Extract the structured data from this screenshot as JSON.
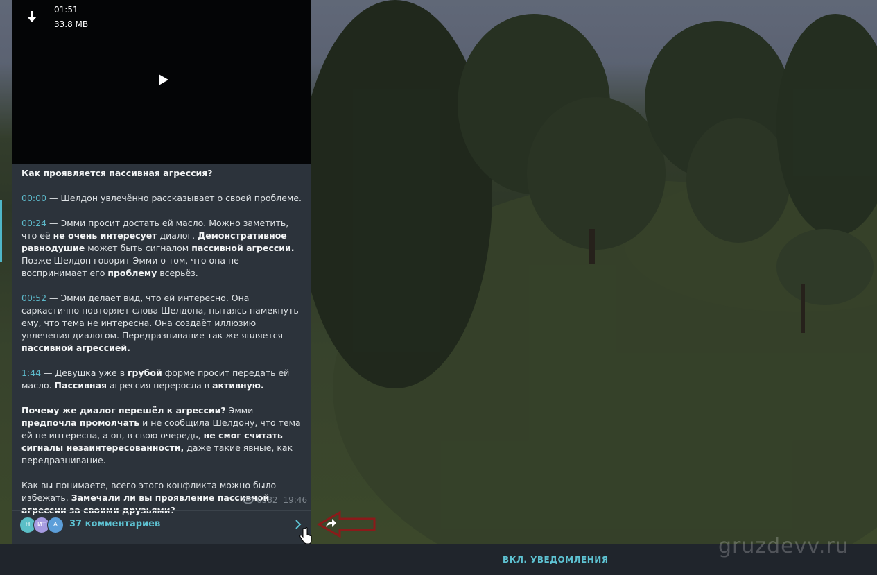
{
  "video": {
    "duration": "01:51",
    "size": "33.8 MB",
    "download_icon": "download-arrow-icon",
    "play_icon": "play-icon"
  },
  "post": {
    "title": "Как проявляется пассивная агрессия?",
    "p1_time": "00:00",
    "p1_text": " — Шелдон увлечённо рассказывает о своей проблеме.",
    "p2_time": "00:24",
    "p2_a": " — Эмми просит достать ей масло. Можно заметить, что её ",
    "p2_b": "не очень интересует",
    "p2_c": " диалог. ",
    "p2_d": "Демонстративное равнодушие",
    "p2_e": " может быть сигналом ",
    "p2_f": "пассивной агрессии.",
    "p2_g": " Позже Шелдон говорит Эмми о том, что она не воспринимает его ",
    "p2_h": "проблему",
    "p2_i": " всерьёз.",
    "p3_time": "00:52",
    "p3_a": " — Эмми делает вид, что ей интересно. Она саркастично повторяет слова Шелдона, пытаясь намекнуть ему, что тема не интересна. Она создаёт иллюзию увлечения диалогом. Передразнивание так же является ",
    "p3_b": "пассивной агрессией.",
    "p4_time": "1:44",
    "p4_a": " — Девушка уже в ",
    "p4_b": "грубой",
    "p4_c": " форме просит передать ей масло. ",
    "p4_d": "Пассивная",
    "p4_e": " агрессия переросла в ",
    "p4_f": "активную.",
    "p5_a": "Почему же диалог перешёл к агрессии?",
    "p5_b": " Эмми ",
    "p5_c": "предпочла промолчать",
    "p5_d": " и не сообщила Шелдону, что тема ей не интересна, а он, в свою очередь, ",
    "p5_e": "не смог считать сигналы незаинтересованности,",
    "p5_f": " даже такие явные, как передразнивание.",
    "p6_a": "Как вы понимаете, всего этого конфликта можно было избежать. ",
    "p6_b": "Замечали ли вы проявление пассивной агрессии за своими друзьями?",
    "views": "6582",
    "time": "19:46"
  },
  "comments": {
    "avatars": [
      "Н",
      "ИТ",
      "А"
    ],
    "label": "37 комментариев"
  },
  "bottom": {
    "notify_label": "ВКЛ. УВЕДОМЛЕНИЯ"
  },
  "watermark": "gruzdevv.ru",
  "colors": {
    "accent": "#5ec3d3",
    "card_bg": "#2c333b",
    "annotation_arrow": "#8b1a1a"
  }
}
